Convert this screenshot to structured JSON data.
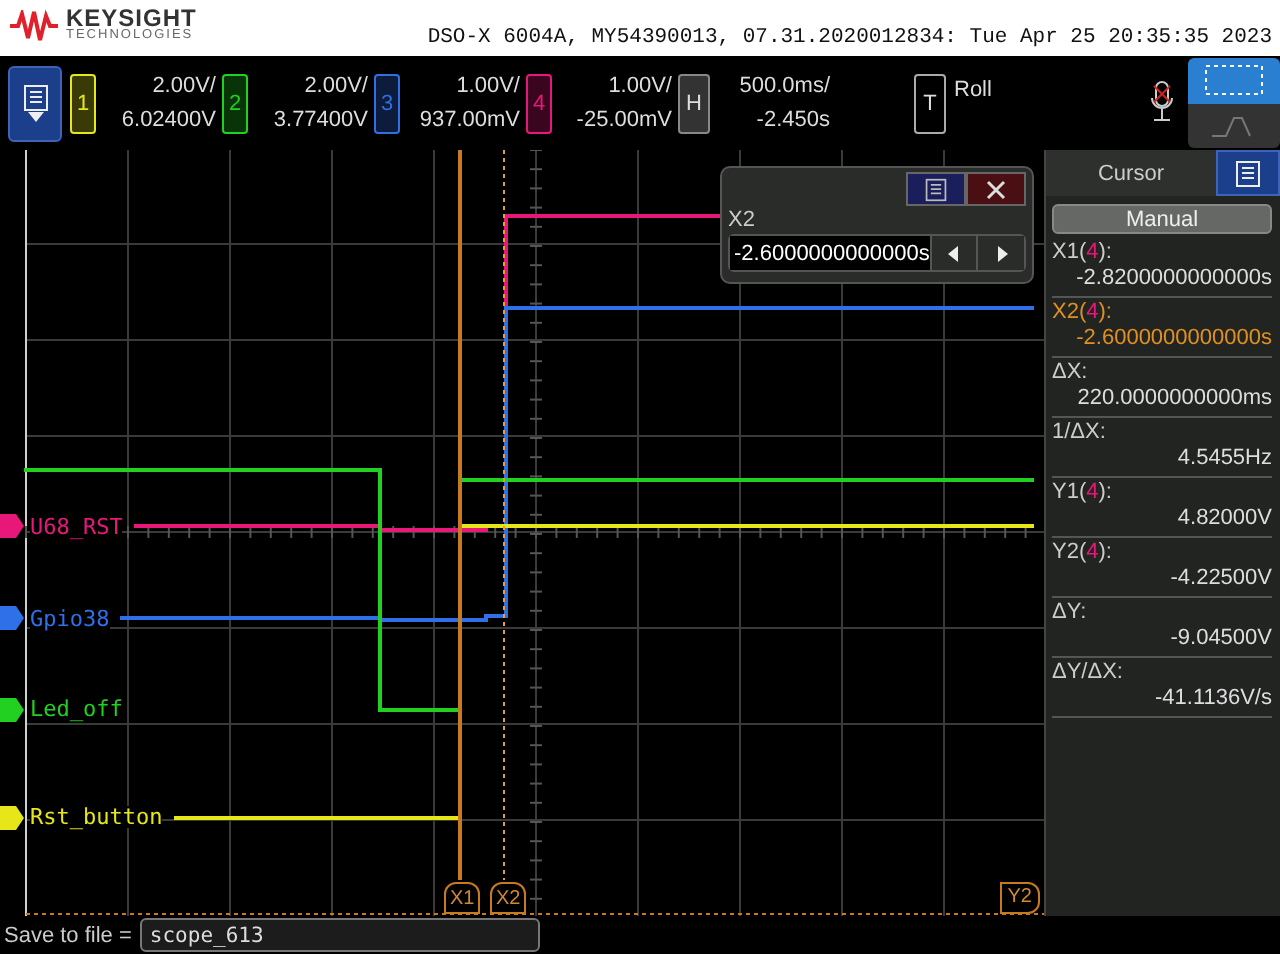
{
  "header": {
    "brand": "KEYSIGHT",
    "brand_sub": "TECHNOLOGIES",
    "title": "DSO-X 6004A, MY54390013, 07.31.2020012834: Tue Apr 25 20:35:35 2023"
  },
  "channels": [
    {
      "number": "1",
      "scale": "2.00V/",
      "offset": "6.02400V",
      "color": "#e6e619"
    },
    {
      "number": "2",
      "scale": "2.00V/",
      "offset": "3.77400V",
      "color": "#22d022"
    },
    {
      "number": "3",
      "scale": "1.00V/",
      "offset": "937.00mV",
      "color": "#2f6fe8"
    },
    {
      "number": "4",
      "scale": "1.00V/",
      "offset": "-25.00mV",
      "color": "#e8187a"
    }
  ],
  "horizontal": {
    "label": "H",
    "scale": "500.0ms/",
    "delay": "-2.450s"
  },
  "trigger": {
    "label": "T",
    "mode": "Roll"
  },
  "traces": [
    {
      "label": "U68_RST",
      "color": "#e8187a"
    },
    {
      "label": "Gpio38",
      "color": "#2f6fe8"
    },
    {
      "label": "Led_off",
      "color": "#22d022"
    },
    {
      "label": "Rst_button",
      "color": "#e6e619"
    }
  ],
  "cursor_markers": [
    "X1",
    "X2"
  ],
  "y_marker": "Y2",
  "popup": {
    "title": "X2",
    "value": "-2.6000000000000s"
  },
  "cursor_panel": {
    "title": "Cursor",
    "mode": "Manual",
    "readings": [
      {
        "prefix": "X1(",
        "source": "4",
        "suffix": "):",
        "value": "-2.8200000000000s",
        "selected": false
      },
      {
        "prefix": "X2(",
        "source": "4",
        "suffix": "):",
        "value": "-2.6000000000000s",
        "selected": true
      },
      {
        "prefix": "ΔX:",
        "value": "220.0000000000ms",
        "selected": false
      },
      {
        "prefix": "1/ΔX:",
        "value": "4.5455Hz",
        "selected": false
      },
      {
        "prefix": "Y1(",
        "source": "4",
        "suffix": "):",
        "value": "4.82000V",
        "selected": false
      },
      {
        "prefix": "Y2(",
        "source": "4",
        "suffix": "):",
        "value": "-4.22500V",
        "selected": false
      },
      {
        "prefix": "ΔY:",
        "value": "-9.04500V",
        "selected": false
      },
      {
        "prefix": "ΔY/ΔX:",
        "value": "-41.1136V/s",
        "selected": false
      }
    ]
  },
  "save_bar": {
    "label": "Save to file =",
    "value": "scope_613"
  }
}
